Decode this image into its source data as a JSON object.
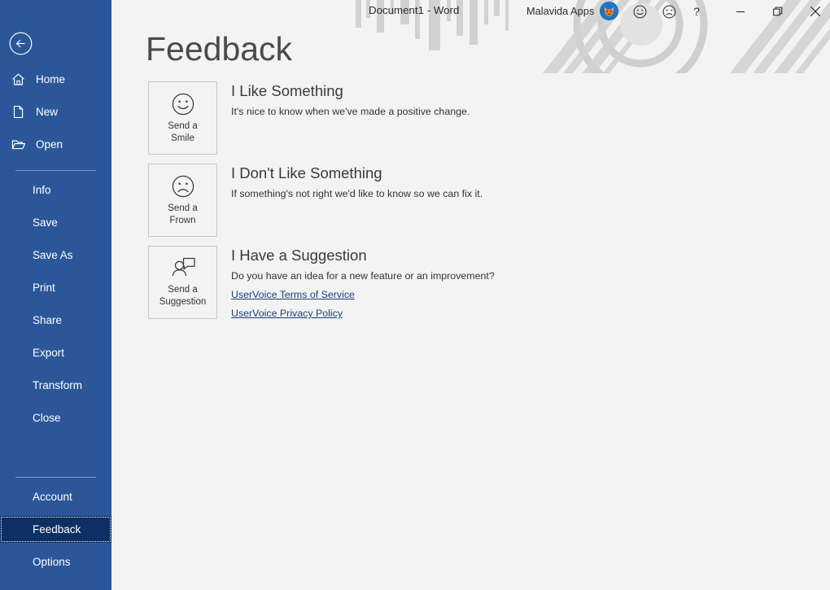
{
  "titlebar": {
    "document_title": "Document1  -  Word",
    "account_name": "Malavida Apps",
    "avatar_name": "user-avatar",
    "smile_icon_label": "Send a Smile",
    "frown_icon_label": "Send a Frown",
    "help_label": "?",
    "minimize_label": "Minimize",
    "restore_label": "Restore Down",
    "close_label": "Close"
  },
  "sidebar": {
    "back_label": "Back",
    "top_items": [
      {
        "label": "Home",
        "icon": "home-icon"
      },
      {
        "label": "New",
        "icon": "new-document-icon"
      },
      {
        "label": "Open",
        "icon": "open-folder-icon"
      }
    ],
    "middle_items": [
      {
        "label": "Info"
      },
      {
        "label": "Save"
      },
      {
        "label": "Save As"
      },
      {
        "label": "Print"
      },
      {
        "label": "Share"
      },
      {
        "label": "Export"
      },
      {
        "label": "Transform"
      },
      {
        "label": "Close"
      }
    ],
    "bottom_items": [
      {
        "label": "Account",
        "selected": false
      },
      {
        "label": "Feedback",
        "selected": true
      },
      {
        "label": "Options",
        "selected": false
      }
    ],
    "selected_item": "Feedback",
    "background_color": "#2b579a",
    "selected_color": "#0d2f63"
  },
  "main": {
    "page_title": "Feedback",
    "sections": [
      {
        "button_label_line1": "Send a",
        "button_label_line2": "Smile",
        "button_icon": "smile-face-icon",
        "heading": "I Like Something",
        "description": "It's nice to know when we've made a positive change.",
        "links": []
      },
      {
        "button_label_line1": "Send a",
        "button_label_line2": "Frown",
        "button_icon": "frown-face-icon",
        "heading": "I Don't Like Something",
        "description": "If something's not right we'd like to know so we can fix it.",
        "links": []
      },
      {
        "button_label_line1": "Send a",
        "button_label_line2": "Suggestion",
        "button_icon": "person-speech-bubble-icon",
        "heading": "I Have a Suggestion",
        "description": "Do you have an idea for a new feature or an improvement?",
        "links": [
          "UserVoice Terms of Service",
          "UserVoice Privacy Policy"
        ]
      }
    ]
  },
  "colors": {
    "accent": "#2b579a",
    "selected": "#0d2f63",
    "content_bg": "#f3f3f3",
    "link": "#1b3f7a"
  }
}
